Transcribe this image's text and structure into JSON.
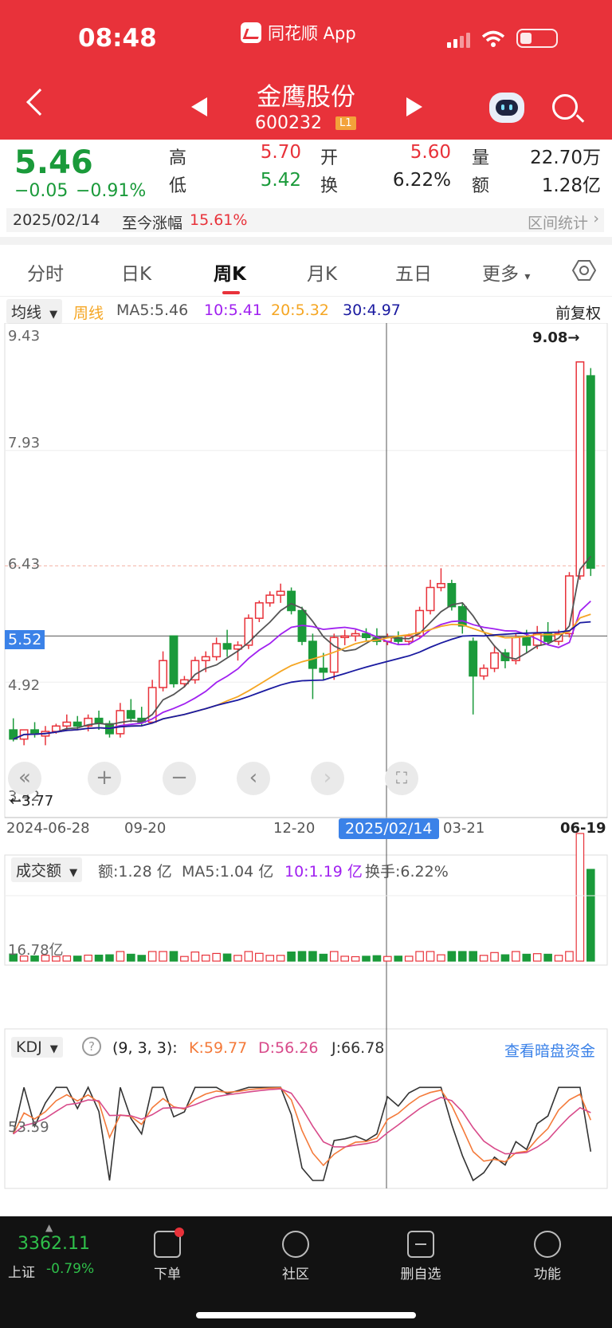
{
  "status": {
    "time": "08:48",
    "app_label": "同花顺 App"
  },
  "header": {
    "name": "金鹰股份",
    "code": "600232",
    "badge": "L1"
  },
  "quote": {
    "price": "5.46",
    "change": "−0.05",
    "change_pct": "−0.91%",
    "high_label": "高",
    "high": "5.70",
    "low_label": "低",
    "low": "5.42",
    "open_label": "开",
    "open": "5.60",
    "turnover_label": "换",
    "turnover": "6.22%",
    "volume_label": "量",
    "volume": "22.70万",
    "amount_label": "额",
    "amount": "1.28亿",
    "date": "2025/02/14",
    "since_label": "至今涨幅",
    "since_value": "15.61%",
    "interval_stats": "区间统计"
  },
  "tabs": [
    {
      "label": "分时"
    },
    {
      "label": "日K"
    },
    {
      "label": "周K"
    },
    {
      "label": "月K"
    },
    {
      "label": "五日"
    },
    {
      "label": "更多"
    }
  ],
  "ma": {
    "dropdown": "均线",
    "period": "周线",
    "ma5": "MA5:5.46",
    "ma10": "10:5.41",
    "ma20": "20:5.32",
    "ma30": "30:4.97",
    "adjust": "前复权"
  },
  "price_axis": {
    "top": "9.43",
    "l2": "7.93",
    "l3": "6.43",
    "l4": "4.92",
    "l5": "3.42",
    "cursor": "5.52",
    "max_marker": "9.08→",
    "min_marker": "←3.77"
  },
  "date_axis": {
    "d1": "2024-06-28",
    "d2": "09-20",
    "d3": "12-20",
    "active": "2025/02/14",
    "d4": "03-21",
    "d5": "06-19"
  },
  "amount_panel": {
    "dropdown": "成交额",
    "amount": "额:1.28 亿",
    "ma5": "MA5:1.04 亿",
    "ma10": "10:1.19 亿",
    "turnover": "换手:6.22%",
    "axis_label": "16.78亿"
  },
  "kdj_panel": {
    "dropdown": "KDJ",
    "params": "(9, 3, 3):",
    "k": "K:59.77",
    "d": "D:56.26",
    "j": "J:66.78",
    "link": "查看暗盘资金",
    "axis_label": "53.59"
  },
  "nav": {
    "index_value": "3362.11",
    "index_name": "上证",
    "index_change": "-0.79%",
    "items": [
      {
        "label": "下单"
      },
      {
        "label": "社区"
      },
      {
        "label": "删自选"
      },
      {
        "label": "功能"
      }
    ]
  },
  "colors": {
    "up": "#e8323a",
    "down": "#1a9a3a",
    "accent": "#3b82e8"
  },
  "chart_data": [
    {
      "type": "candlestick",
      "series": [
        {
          "name": "周K",
          "ohlc": [
            [
              4.3,
              4.45,
              4.18,
              4.15
            ],
            [
              4.18,
              4.22,
              4.3,
              4.1
            ],
            [
              4.3,
              4.4,
              4.25,
              4.2
            ],
            [
              4.22,
              4.35,
              4.28,
              4.1
            ],
            [
              4.28,
              4.38,
              4.35,
              4.25
            ],
            [
              4.35,
              4.5,
              4.4,
              4.3
            ],
            [
              4.4,
              4.48,
              4.35,
              4.3
            ],
            [
              4.35,
              4.5,
              4.45,
              4.28
            ],
            [
              4.45,
              4.55,
              4.38,
              4.3
            ],
            [
              4.38,
              4.42,
              4.25,
              4.2
            ],
            [
              4.25,
              4.65,
              4.55,
              4.2
            ],
            [
              4.55,
              4.7,
              4.45,
              4.4
            ],
            [
              4.45,
              4.6,
              4.4,
              4.35
            ],
            [
              4.4,
              4.95,
              4.85,
              4.38
            ],
            [
              4.85,
              5.32,
              5.2,
              4.8
            ],
            [
              5.52,
              5.52,
              4.9,
              4.85
            ],
            [
              4.9,
              5.0,
              4.95,
              4.85
            ],
            [
              4.95,
              5.25,
              5.2,
              4.9
            ],
            [
              5.2,
              5.32,
              5.25,
              5.05
            ],
            [
              5.25,
              5.5,
              5.42,
              5.2
            ],
            [
              5.42,
              5.6,
              5.35,
              5.25
            ],
            [
              5.35,
              5.45,
              5.4,
              5.2
            ],
            [
              5.4,
              5.8,
              5.75,
              5.35
            ],
            [
              5.75,
              5.98,
              5.95,
              5.7
            ],
            [
              5.95,
              6.1,
              6.05,
              5.9
            ],
            [
              6.05,
              6.2,
              6.1,
              5.95
            ],
            [
              6.1,
              6.15,
              5.85,
              5.8
            ],
            [
              5.85,
              5.9,
              5.45,
              5.4
            ],
            [
              5.45,
              5.55,
              5.1,
              4.7
            ],
            [
              5.1,
              5.3,
              5.05,
              4.95
            ],
            [
              5.05,
              5.55,
              5.5,
              4.95
            ],
            [
              5.5,
              5.6,
              5.52,
              5.4
            ],
            [
              5.52,
              5.6,
              5.55,
              5.45
            ],
            [
              5.55,
              5.62,
              5.5,
              5.45
            ],
            [
              5.5,
              5.62,
              5.45,
              5.4
            ],
            [
              5.45,
              5.55,
              5.5,
              5.4
            ],
            [
              5.5,
              5.58,
              5.45,
              5.4
            ],
            [
              5.45,
              5.55,
              5.52,
              5.4
            ],
            [
              5.52,
              5.9,
              5.85,
              5.5
            ],
            [
              5.85,
              6.25,
              6.15,
              5.8
            ],
            [
              6.15,
              6.4,
              6.2,
              6.1
            ],
            [
              6.2,
              6.25,
              5.9,
              5.85
            ],
            [
              5.9,
              5.95,
              5.65,
              5.55
            ],
            [
              5.45,
              5.5,
              5.0,
              4.5
            ],
            [
              5.0,
              5.15,
              5.1,
              4.95
            ],
            [
              5.1,
              5.4,
              5.3,
              5.05
            ],
            [
              5.3,
              5.35,
              5.2,
              5.1
            ],
            [
              5.2,
              5.55,
              5.5,
              5.15
            ],
            [
              5.5,
              5.6,
              5.4,
              5.3
            ],
            [
              5.4,
              5.65,
              5.55,
              5.35
            ],
            [
              5.55,
              5.7,
              5.45,
              5.4
            ],
            [
              5.45,
              5.6,
              5.55,
              5.4
            ],
            [
              5.55,
              6.35,
              6.3,
              5.5
            ],
            [
              6.3,
              9.08,
              9.08,
              6.25
            ],
            [
              8.9,
              9.0,
              6.4,
              6.3
            ]
          ]
        }
      ],
      "moving_averages": [
        {
          "name": "MA5",
          "color": "#555555"
        },
        {
          "name": "MA10",
          "color": "#a020f0"
        },
        {
          "name": "MA20",
          "color": "#f5a623"
        },
        {
          "name": "MA30",
          "color": "#1a1aa0"
        }
      ],
      "ylim": [
        3.42,
        9.43
      ]
    }
  ]
}
